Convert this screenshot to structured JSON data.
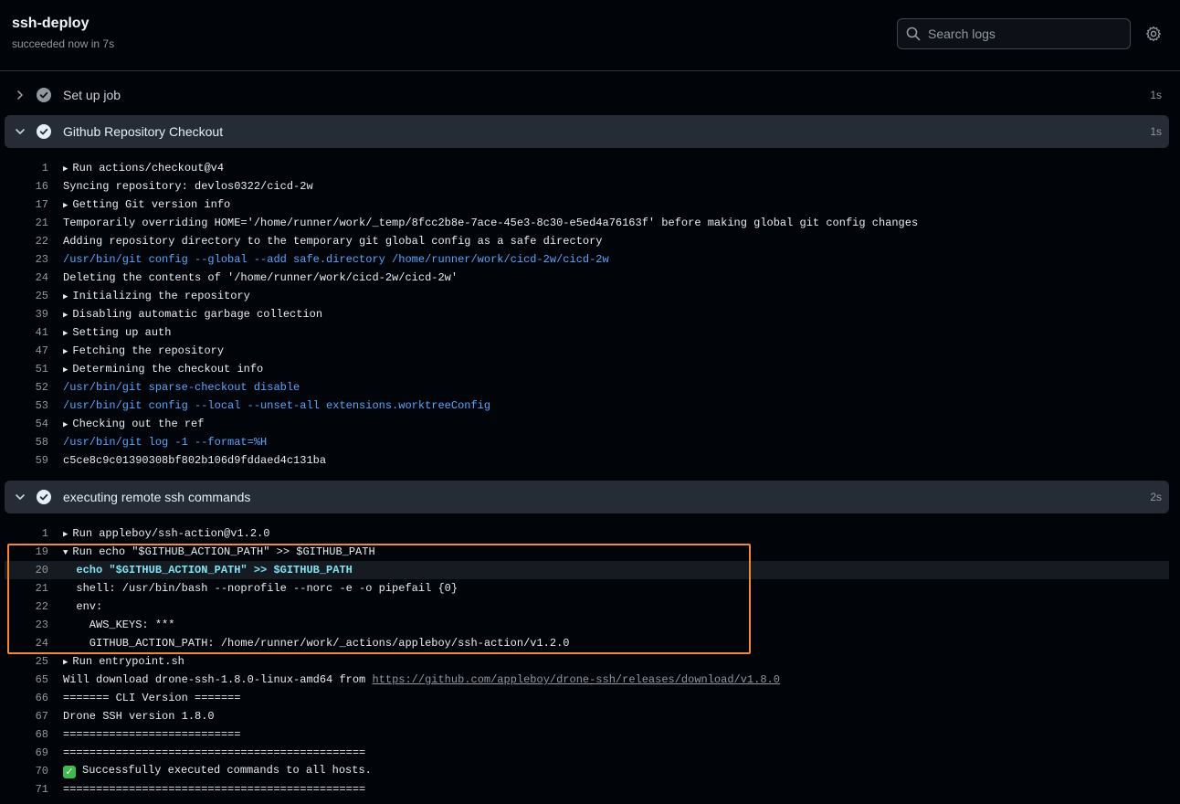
{
  "header": {
    "title": "ssh-deploy",
    "status": "succeeded now in 7s",
    "search_placeholder": "Search logs"
  },
  "steps": [
    {
      "name": "Set up job",
      "duration": "1s",
      "expanded": false
    },
    {
      "name": "Github Repository Checkout",
      "duration": "1s",
      "expanded": true
    },
    {
      "name": "executing remote ssh commands",
      "duration": "2s",
      "expanded": true
    }
  ],
  "checkout_log": [
    {
      "n": "1",
      "t": "Run actions/checkout@v4",
      "group": true
    },
    {
      "n": "16",
      "t": "Syncing repository: devlos0322/cicd-2w"
    },
    {
      "n": "17",
      "t": "Getting Git version info",
      "group": true
    },
    {
      "n": "21",
      "t": "Temporarily overriding HOME='/home/runner/work/_temp/8fcc2b8e-7ace-45e3-8c30-e5ed4a76163f' before making global git config changes"
    },
    {
      "n": "22",
      "t": "Adding repository directory to the temporary git global config as a safe directory"
    },
    {
      "n": "23",
      "t": "/usr/bin/git config --global --add safe.directory /home/runner/work/cicd-2w/cicd-2w",
      "cmd": true
    },
    {
      "n": "24",
      "t": "Deleting the contents of '/home/runner/work/cicd-2w/cicd-2w'"
    },
    {
      "n": "25",
      "t": "Initializing the repository",
      "group": true
    },
    {
      "n": "39",
      "t": "Disabling automatic garbage collection",
      "group": true
    },
    {
      "n": "41",
      "t": "Setting up auth",
      "group": true
    },
    {
      "n": "47",
      "t": "Fetching the repository",
      "group": true
    },
    {
      "n": "51",
      "t": "Determining the checkout info",
      "group": true
    },
    {
      "n": "52",
      "t": "/usr/bin/git sparse-checkout disable",
      "cmd": true
    },
    {
      "n": "53",
      "t": "/usr/bin/git config --local --unset-all extensions.worktreeConfig",
      "cmd": true
    },
    {
      "n": "54",
      "t": "Checking out the ref",
      "group": true
    },
    {
      "n": "58",
      "t": "/usr/bin/git log -1 --format=%H",
      "cmd": true
    },
    {
      "n": "59",
      "t": "c5ce8c9c01390308bf802b106d9fddaed4c131ba"
    }
  ],
  "ssh_log": [
    {
      "n": "1",
      "t": "Run appleboy/ssh-action@v1.2.0",
      "group": true
    },
    {
      "n": "19",
      "t": "Run echo \"$GITHUB_ACTION_PATH\" >> $GITHUB_PATH",
      "group": true,
      "open": true
    },
    {
      "n": "20",
      "t": "  echo \"$GITHUB_ACTION_PATH\" >> $GITHUB_PATH",
      "cyan": true,
      "hl": true
    },
    {
      "n": "21",
      "t": "  shell: /usr/bin/bash --noprofile --norc -e -o pipefail {0}"
    },
    {
      "n": "22",
      "t": "  env:"
    },
    {
      "n": "23",
      "t": "    AWS_KEYS: ***"
    },
    {
      "n": "24",
      "t": "    GITHUB_ACTION_PATH: /home/runner/work/_actions/appleboy/ssh-action/v1.2.0"
    },
    {
      "n": "25",
      "t": "Run entrypoint.sh",
      "group": true
    },
    {
      "n": "65",
      "t": "Will download drone-ssh-1.8.0-linux-amd64 from ",
      "link": "https://github.com/appleboy/drone-ssh/releases/download/v1.8.0"
    },
    {
      "n": "66",
      "t": "======= CLI Version ======="
    },
    {
      "n": "67",
      "t": "Drone SSH version 1.8.0"
    },
    {
      "n": "68",
      "t": "==========================="
    },
    {
      "n": "69",
      "t": "=============================================="
    },
    {
      "n": "70",
      "t": "Successfully executed commands to all hosts.",
      "success": true
    },
    {
      "n": "71",
      "t": "=============================================="
    }
  ],
  "colors": {
    "success": "#3fb950",
    "command": "#58a6ff",
    "highlight_border": "#f0883e"
  }
}
